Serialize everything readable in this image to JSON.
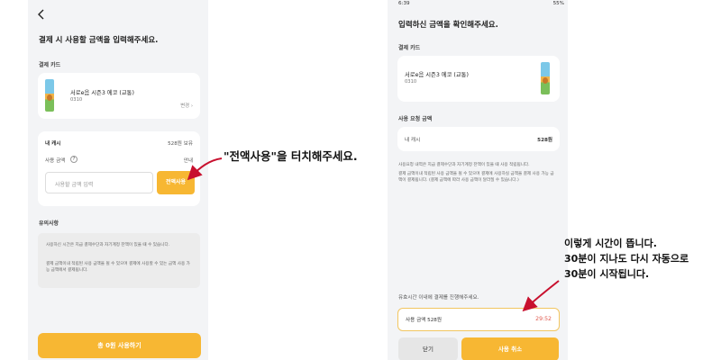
{
  "left_screen": {
    "heading": "결제 시 사용할 금액을 입력해주세요.",
    "card_section_label": "결제 카드",
    "card": {
      "name": "서로e음 시즌3 에코 (교통)",
      "number": "0310",
      "change_label": "변경"
    },
    "cash": {
      "label": "내 캐시",
      "value": "528원 보유",
      "use_label": "사용 금액",
      "use_value": "안내",
      "input_placeholder": "사용할 금액 입력",
      "all_button": "전액사용"
    },
    "notice": {
      "title": "유의사항",
      "items": [
        "사용하신 시간은 지급 결제수단과 자기계정 잔액이 있을 때 수 있습니다.",
        "결제 금액이내 적립된 사용 금액을 될 수 있으며 결제에 사용할 수 있는 금액 사용 가능 금액에서 결제됩니다."
      ]
    },
    "pay_button": "총 0원 사용하기"
  },
  "right_screen": {
    "status_time": "6:39",
    "status_battery": "55%",
    "heading": "입력하신 금액을 확인해주세요.",
    "card_section_label": "결제 카드",
    "card": {
      "name": "서로e음 시즌3 에코 (교통)",
      "number": "0310"
    },
    "request_section_label": "사용 요청 금액",
    "request": {
      "label": "내 캐시",
      "value": "528원"
    },
    "notice_items": [
      "사용요청 내역은 지급 결제수단과 자기계정 잔액이 있을 때 사용 적립됩니다.",
      "결제 금액이내 적립된 사용 금액을 될 수 있으며 결제에 사용하실 금액을 결제 사용 가능 금액이 결제됩니다. (결제 금액에 따라 사용 금액이 달라질 수 있습니다.)"
    ],
    "timer_instruction": "유효시간 이내에 결제를 진행해주세요.",
    "timer": {
      "label": "사용 금액 528원",
      "remaining": "29:52"
    },
    "close_button": "닫기",
    "cancel_button": "사용 취소"
  },
  "annotations": {
    "callout_1": "\"전액사용\"을 터치해주세요.",
    "callout_2_lines": [
      "이렇게 시간이 뜹니다.",
      "30분이 지나도 다시 자동으로",
      "30분이 시작됩니다."
    ]
  },
  "colors": {
    "accent": "#f7b733",
    "timer_text": "#e05a4e",
    "arrow": "#c8102e"
  }
}
